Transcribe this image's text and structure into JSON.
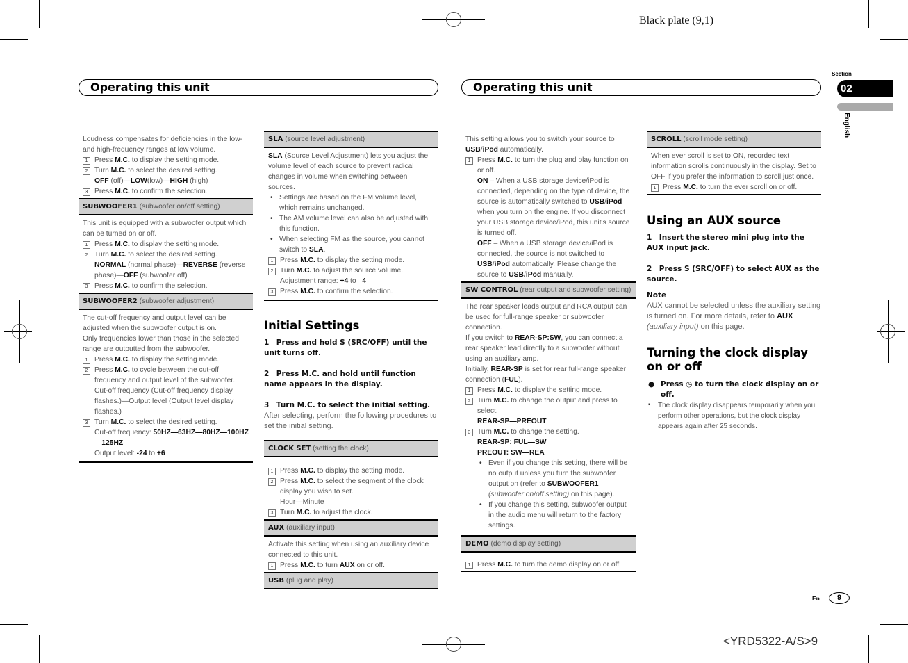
{
  "plate_label": "Black plate (9,1)",
  "left_header": "Operating this unit",
  "right_header": "Operating this unit",
  "section": {
    "label": "Section",
    "number": "02",
    "language": "English"
  },
  "footer": {
    "lang": "En",
    "page": "9",
    "code": "<YRD5322-A/S>9"
  },
  "col1": {
    "loudness": {
      "intro": "Loudness compensates for deficiencies in the low- and high-frequency ranges at low volume.",
      "step1": [
        "Press ",
        "M.C.",
        " to display the setting mode."
      ],
      "step2": [
        "Turn ",
        "M.C.",
        " to select the desired setting."
      ],
      "options": [
        [
          "OFF",
          " (off)—"
        ],
        [
          "LOW",
          "(low)—"
        ],
        [
          "HIGH",
          " (high)"
        ]
      ],
      "step3": [
        "Press ",
        "M.C.",
        " to confirm the selection."
      ]
    },
    "subwoofer1": {
      "title": "SUBWOOFER1",
      "subtitle": " (subwoofer on/off setting)",
      "intro": "This unit is equipped with a subwoofer output which can be turned on or off.",
      "step1": [
        "Press ",
        "M.C.",
        " to display the setting mode."
      ],
      "step2": [
        "Turn ",
        "M.C.",
        " to select the desired setting."
      ],
      "options": [
        [
          "NORMAL",
          " (normal phase)—"
        ],
        [
          "REVERSE",
          " (reverse phase)—"
        ],
        [
          "OFF",
          " (subwoofer off)"
        ]
      ],
      "step3": [
        "Press ",
        "M.C.",
        " to confirm the selection."
      ]
    },
    "subwoofer2": {
      "title": "SUBWOOFER2",
      "subtitle": " (subwoofer adjustment)",
      "intro1": "The cut-off frequency and output level can be adjusted when the subwoofer output is on.",
      "intro2": "Only frequencies lower than those in the selected range are outputted from the subwoofer.",
      "step1": [
        "Press ",
        "M.C.",
        " to display the setting mode."
      ],
      "step2": [
        "Press ",
        "M.C.",
        " to cycle between the cut-off frequency and output level of the subwoofer."
      ],
      "step2_detail": "Cut-off frequency (Cut-off frequency display flashes.)—Output level (Output level display flashes.)",
      "step3": [
        "Turn ",
        "M.C.",
        " to select the desired setting."
      ],
      "freq_label": "Cut-off frequency: ",
      "freq_values": "50HZ—63HZ—80HZ—100HZ—125HZ",
      "level_label": "Output level: ",
      "level_min": "-24",
      "level_to": " to ",
      "level_max": "+6"
    }
  },
  "col2": {
    "sla": {
      "title": "SLA",
      "subtitle": " (source level adjustment)",
      "intro_bold": "SLA",
      "intro": " (Source Level Adjustment) lets you adjust the volume level of each source to prevent radical changes in volume when switching between sources.",
      "bullets": [
        "Settings are based on the FM volume level, which remains unchanged.",
        "The AM volume level can also be adjusted with this function."
      ],
      "bullet3": [
        "When selecting FM as the source, you cannot switch to ",
        "SLA",
        "."
      ],
      "step1": [
        "Press ",
        "M.C.",
        " to display the setting mode."
      ],
      "step2": [
        "Turn ",
        "M.C.",
        " to adjust the source volume."
      ],
      "range_label": "Adjustment range: ",
      "range_max": "+4",
      "range_to": " to ",
      "range_min": "–4",
      "step3": [
        "Press ",
        "M.C.",
        " to confirm the selection."
      ]
    },
    "initial": {
      "heading": "Initial Settings",
      "steps": [
        "1 Press and hold S (SRC/OFF) until the unit turns off.",
        "2 Press M.C. and hold until function name appears in the display.",
        "3 Turn M.C. to select the initial setting."
      ],
      "after": "After selecting, perform the following procedures to set the initial setting."
    },
    "clock_set": {
      "title": "CLOCK SET",
      "subtitle": " (setting the clock)",
      "step1": [
        "Press ",
        "M.C.",
        " to display the setting mode."
      ],
      "step2": [
        "Press ",
        "M.C.",
        " to select the segment of the clock display you wish to set."
      ],
      "step2_detail": "Hour—Minute",
      "step3": [
        "Turn ",
        "M.C.",
        " to adjust the clock."
      ]
    },
    "aux": {
      "title": "AUX",
      "subtitle": " (auxiliary input)",
      "intro": "Activate this setting when using an auxiliary device connected to this unit.",
      "step1": [
        "Press ",
        "M.C.",
        " to turn ",
        "AUX",
        " on or off."
      ]
    },
    "usb": {
      "title": "USB",
      "subtitle": " (plug and play)"
    }
  },
  "col3": {
    "usb": {
      "intro": [
        "This setting allows you to switch your source to ",
        "USB",
        "/",
        "iPod",
        " automatically."
      ],
      "step1": [
        "Press ",
        "M.C.",
        " to turn the plug and play function on or off."
      ],
      "on": [
        "ON",
        " – When a USB storage device/iPod is connected, depending on the type of device, the source is automatically switched to ",
        "USB",
        "/",
        "iPod",
        " when you turn on the engine. If you disconnect your USB storage device/iPod, this unit's source is turned off."
      ],
      "off": [
        "OFF",
        " – When a USB storage device/iPod is connected, the source is not switched to ",
        "USB",
        "/",
        "iPod",
        " automatically. Please change the source to ",
        "USB",
        "/",
        "iPod",
        " manually."
      ]
    },
    "sw_control": {
      "title": "SW CONTROL",
      "subtitle": " (rear output and subwoofer setting)",
      "p1": "The rear speaker leads output and RCA output can be used for full-range speaker or subwoofer connection.",
      "p2": [
        "If you switch to ",
        "REAR-SP",
        ":",
        "SW",
        ", you can connect a rear speaker lead directly to a subwoofer without using an auxiliary amp."
      ],
      "p3": [
        "Initially, ",
        "REAR-SP",
        " is set for rear full-range speaker connection (",
        "FUL",
        ")."
      ],
      "step1": [
        "Press ",
        "M.C.",
        " to display the setting mode."
      ],
      "step2": [
        "Turn ",
        "M.C.",
        " to change the output and press to select."
      ],
      "step2_detail": "REAR-SP—PREOUT",
      "step3": [
        "Turn ",
        "M.C.",
        " to change the setting."
      ],
      "rear_line": "REAR-SP: FUL—SW",
      "preout_line": "PREOUT: SW—REA",
      "bullet1": [
        "Even if you change this setting, there will be no output unless you turn the subwoofer output on (refer to ",
        "SUBWOOFER1",
        " ",
        "(subwoofer on/off setting)",
        " on this page)."
      ],
      "bullet2": "If you change this setting, subwoofer output in the audio menu will return to the factory settings."
    },
    "demo": {
      "title": "DEMO",
      "subtitle": " (demo display setting)",
      "step1": [
        "Press ",
        "M.C.",
        " to turn the demo display on or off."
      ]
    }
  },
  "col4": {
    "scroll": {
      "title": "SCROLL",
      "subtitle": " (scroll mode setting)",
      "intro": "When ever scroll is set to ON, recorded text information scrolls continuously in the display. Set to OFF if you prefer the information to scroll just once.",
      "step1": [
        "Press ",
        "M.C.",
        " to turn the ever scroll on or off."
      ]
    },
    "aux_source": {
      "heading": "Using an AUX source",
      "step1": "1 Insert the stereo mini plug into the AUX input jack.",
      "step2": "2 Press S (SRC/OFF) to select AUX as the source.",
      "note_label": "Note",
      "note": [
        "AUX cannot be selected unless the auxiliary setting is turned on. For more details, refer to ",
        "AUX",
        " ",
        "(auxiliary input)",
        " on this page."
      ]
    },
    "clock_display": {
      "heading": "Turning the clock display on or off",
      "step_pre": "Press ",
      "step_icon": "◷",
      "step_post": " to turn the clock display on or off.",
      "note": "The clock display disappears temporarily when you perform other operations, but the clock display appears again after 25 seconds."
    }
  }
}
